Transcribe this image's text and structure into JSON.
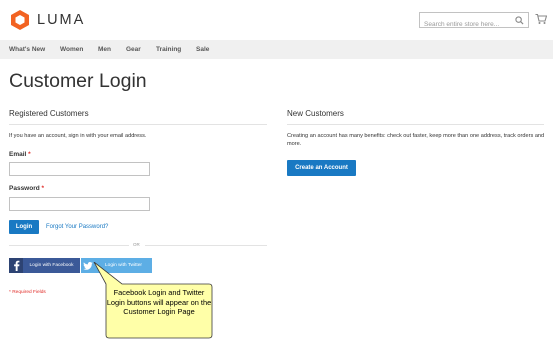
{
  "header": {
    "logo_text": "LUMA",
    "search_placeholder": "Search entire store here...",
    "search_icon": "search-icon",
    "cart_icon": "cart-icon"
  },
  "nav": {
    "items": [
      "What's New",
      "Women",
      "Men",
      "Gear",
      "Training",
      "Sale"
    ]
  },
  "page_title": "Customer Login",
  "registered": {
    "title": "Registered Customers",
    "note": "If you have an account, sign in with your email address.",
    "email_label": "Email",
    "password_label": "Password",
    "required_mark": "*",
    "login_button": "Login",
    "forgot_link": "Forgot Your Password?",
    "or_text": "OR",
    "facebook_button": "Login with Facebook",
    "twitter_button": "Login with Twitter",
    "required_note": "* Required Fields"
  },
  "new_customers": {
    "title": "New Customers",
    "note": "Creating an account has many benefits: check out faster, keep more than one address, track orders and more.",
    "create_button": "Create an Account"
  },
  "callout": {
    "text": "Facebook Login and Twitter Login buttons will appear on the Customer Login Page"
  },
  "colors": {
    "primary": "#1979c3",
    "facebook": "#3b5998",
    "twitter": "#5daee5",
    "logo_orange": "#f26322",
    "required": "#e02b27",
    "callout_fill": "#ffffa8"
  }
}
